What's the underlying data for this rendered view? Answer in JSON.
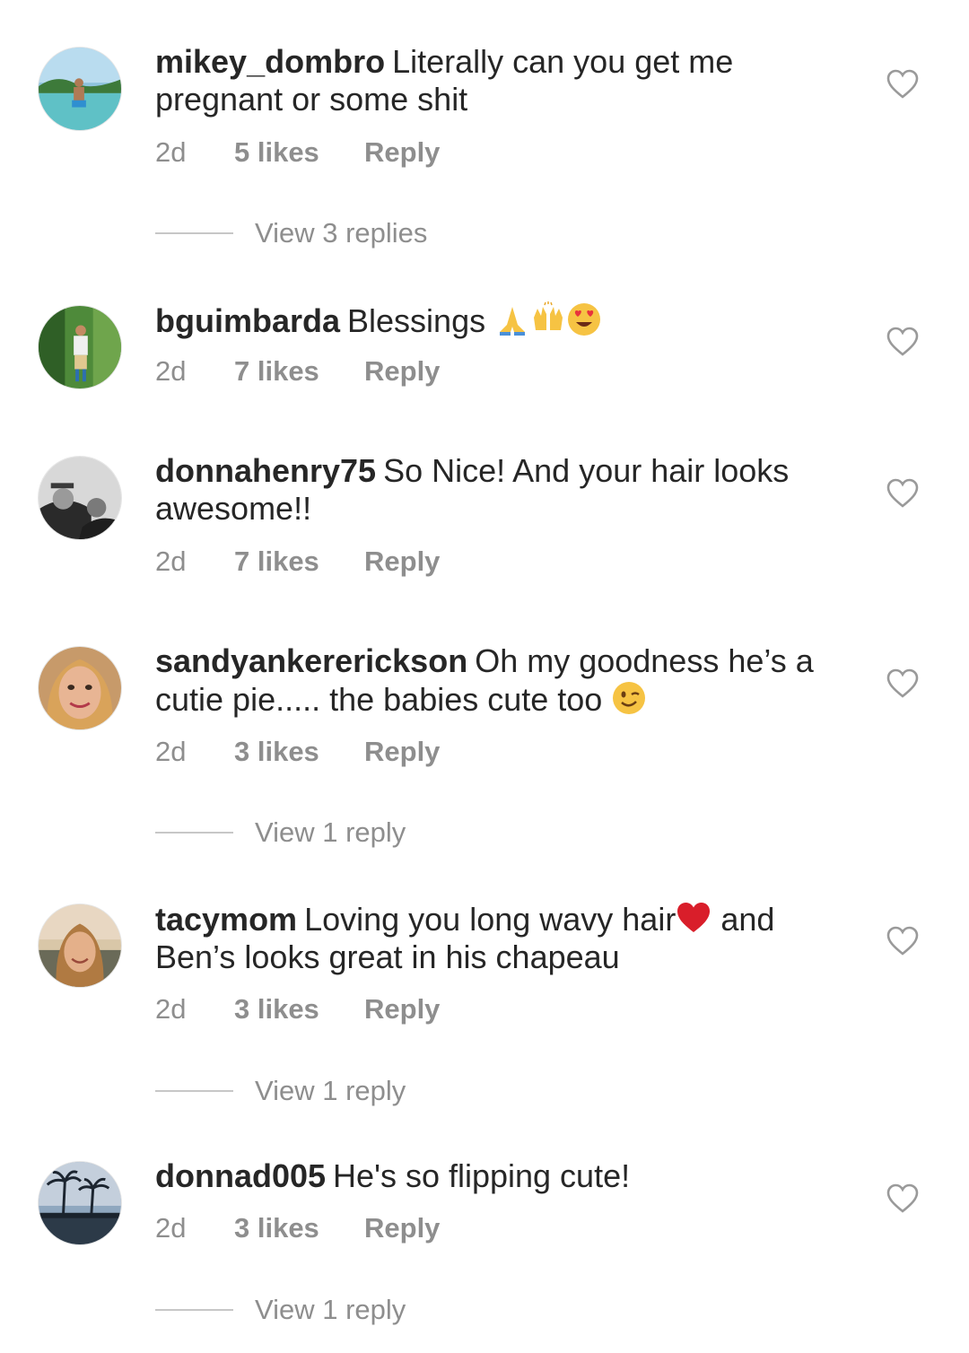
{
  "comments": [
    {
      "username": "mikey_dombro",
      "text": "Literally can you get me pregnant or some shit",
      "time": "2d",
      "likes": "5 likes",
      "reply_label": "Reply",
      "view_replies": "View 3 replies"
    },
    {
      "username": "bguimbarda",
      "text": "Blessings",
      "emojis": [
        "folded-hands-emoji",
        "raising-hands-emoji",
        "heart-eyes-emoji"
      ],
      "time": "2d",
      "likes": "7 likes",
      "reply_label": "Reply"
    },
    {
      "username": "donnahenry75",
      "text": "So Nice! And your hair looks awesome!!",
      "time": "2d",
      "likes": "7 likes",
      "reply_label": "Reply"
    },
    {
      "username": "sandyankererickson",
      "text": "Oh my goodness he’s a cutie pie..... the babies cute too",
      "emojis": [
        "winking-face-emoji"
      ],
      "time": "2d",
      "likes": "3 likes",
      "reply_label": "Reply",
      "view_replies": "View 1 reply"
    },
    {
      "username": "tacymom",
      "text_before": "Loving you long wavy hair",
      "text_after": " and Ben’s looks great in his chapeau",
      "emojis": [
        "red-heart-emoji"
      ],
      "time": "2d",
      "likes": "3 likes",
      "reply_label": "Reply",
      "view_replies": "View 1 reply"
    },
    {
      "username": "donnad005",
      "text": "He's so flipping cute!",
      "time": "2d",
      "likes": "3 likes",
      "reply_label": "Reply",
      "view_replies": "View 1 reply"
    }
  ],
  "icons": {
    "like": "heart-outline-icon"
  },
  "colors": {
    "text": "#262626",
    "secondary": "#8e8e8e",
    "divider": "#c7c7c7"
  }
}
